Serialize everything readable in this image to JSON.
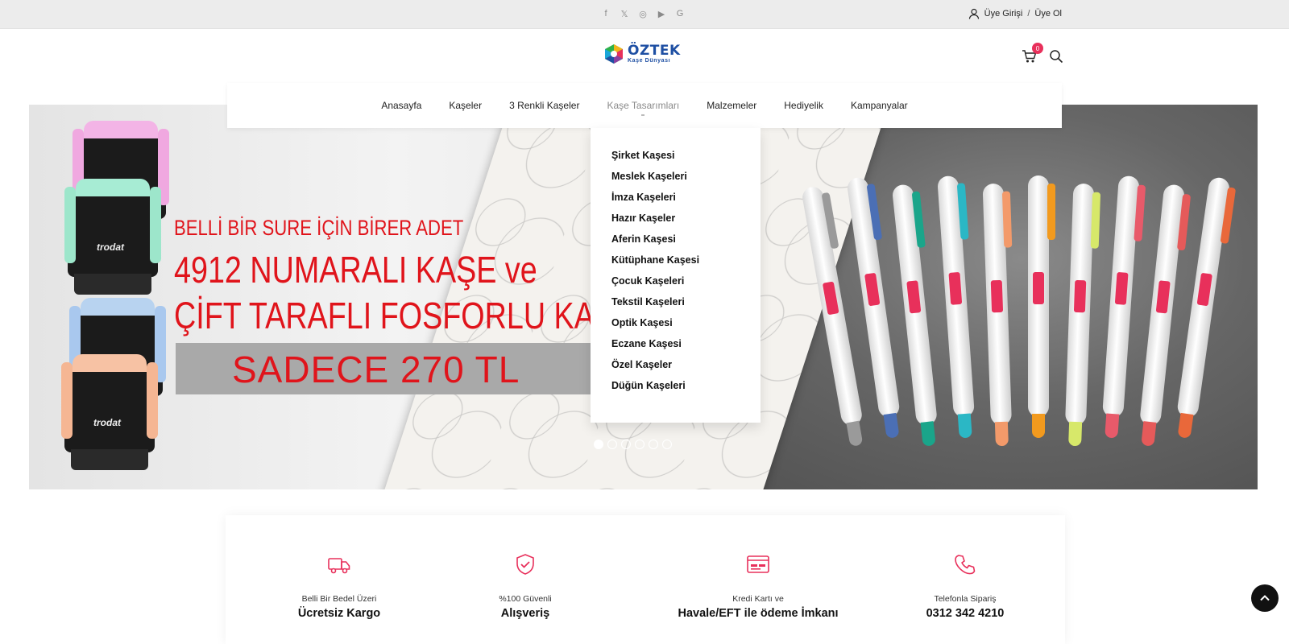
{
  "topbar": {
    "social": [
      {
        "icon": "facebook-icon",
        "glyph": "f"
      },
      {
        "icon": "x-icon",
        "glyph": "𝕏"
      },
      {
        "icon": "instagram-icon",
        "glyph": "◎"
      },
      {
        "icon": "youtube-icon",
        "glyph": "▶"
      },
      {
        "icon": "google-icon",
        "glyph": "G"
      }
    ],
    "login": "Üye Girişi",
    "separator": "/",
    "register": "Üye Ol"
  },
  "header": {
    "logo_title": "ÖZTEK",
    "logo_subtitle": "Kaşe Dünyası",
    "cart_count": "0"
  },
  "nav": {
    "items": [
      {
        "label": "Anasayfa"
      },
      {
        "label": "Kaşeler"
      },
      {
        "label": "3 Renkli Kaşeler"
      },
      {
        "label": "Kaşe Tasarımları"
      },
      {
        "label": "Malzemeler"
      },
      {
        "label": "Hediyelik"
      },
      {
        "label": "Kampanyalar"
      }
    ],
    "active_index": 3
  },
  "dropdown": {
    "items": [
      "Şirket Kaşesi",
      "Meslek Kaşeleri",
      "İmza Kaşeleri",
      "Hazır Kaşeler",
      "Aferin Kaşesi",
      "Kütüphane Kaşesi",
      "Çocuk Kaşeleri",
      "Tekstil Kaşeleri",
      "Optik Kaşesi",
      "Eczane Kaşesi",
      "Özel Kaşeler",
      "Düğün Kaşeleri"
    ]
  },
  "slider": {
    "line1": "BELLİ BİR SURE İÇİN BİRER ADET",
    "line2": "4912 NUMARALI KAŞE ve",
    "line3": "ÇİFT TARAFLI FOSFORLU KALEM",
    "price": "SADECE 270 TL",
    "stamp_brand": "trodat",
    "dot_count": 6,
    "active_dot": 0
  },
  "features": [
    {
      "icon": "truck-icon",
      "small": "Belli Bir Bedel Üzeri",
      "big": "Ücretsiz Kargo"
    },
    {
      "icon": "shield-check-icon",
      "small": "%100 Güvenli",
      "big": "Alışveriş"
    },
    {
      "icon": "credit-card-icon",
      "small": "Kredi Kartı ve",
      "big": "Havale/EFT ile ödeme İmkanı"
    },
    {
      "icon": "phone-icon",
      "small": "Telefonla Sipariş",
      "big": "0312 342 4210"
    }
  ],
  "colors": {
    "accent": "#e8305b",
    "promo_red": "#e0141b",
    "brand_blue": "#1e4fa3"
  }
}
